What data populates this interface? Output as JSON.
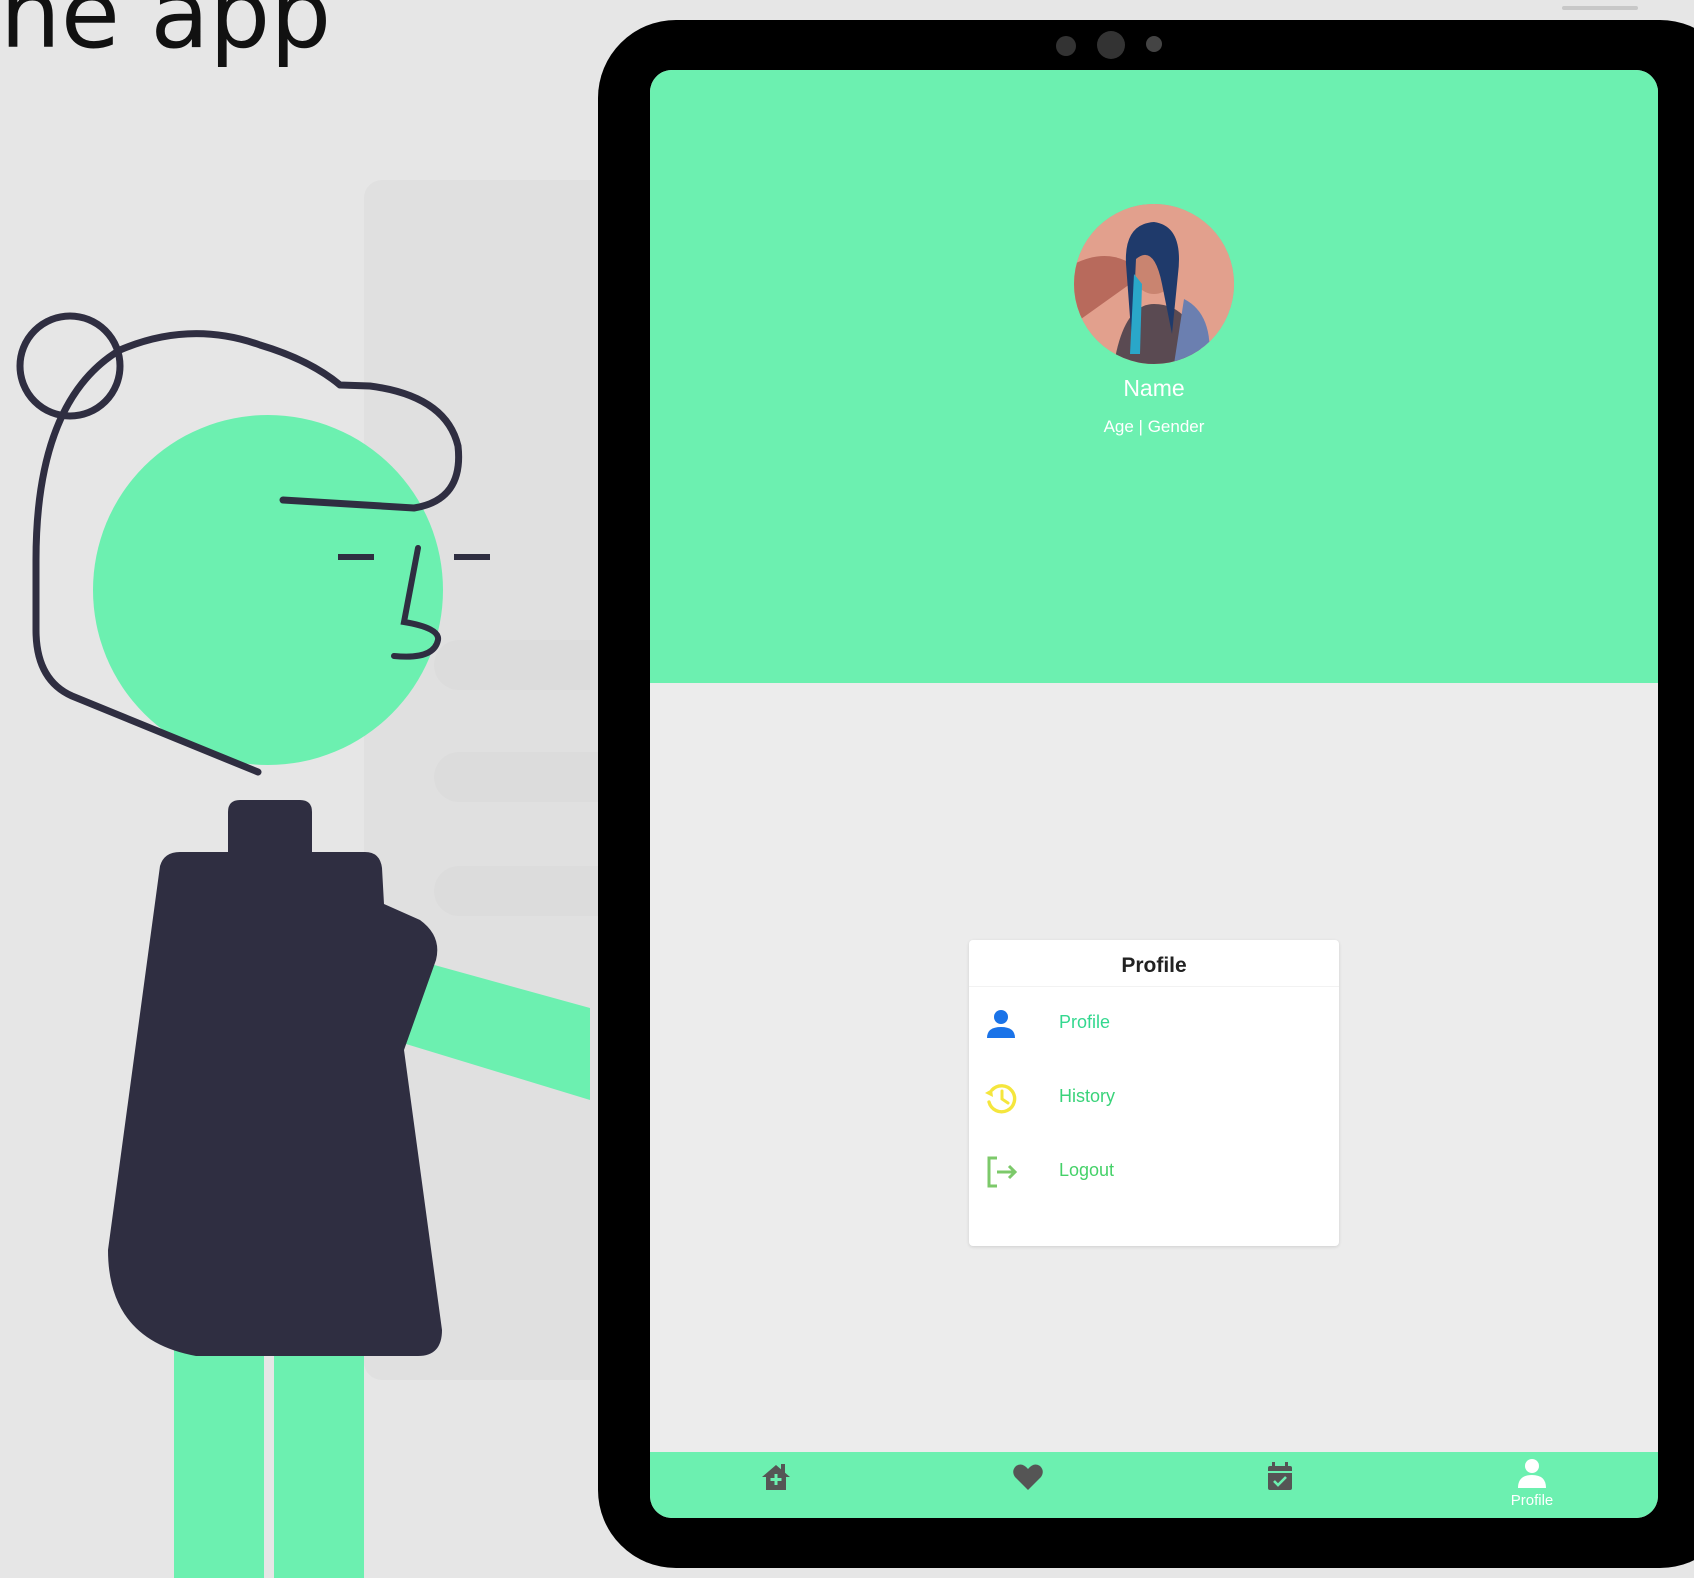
{
  "page": {
    "heading": "he app"
  },
  "profile": {
    "name": "Name",
    "subinfo": "Age | Gender"
  },
  "menu_card": {
    "title": "Profile",
    "items": [
      {
        "label": "Profile",
        "icon": "person-icon",
        "color": "#33d88f"
      },
      {
        "label": "History",
        "icon": "history-icon",
        "color": "#3ad37a"
      },
      {
        "label": "Logout",
        "icon": "logout-icon",
        "color": "#45d168"
      }
    ]
  },
  "bottom_nav": {
    "items": [
      {
        "icon": "home-plus-icon",
        "label": ""
      },
      {
        "icon": "heart-icon",
        "label": ""
      },
      {
        "icon": "calendar-check-icon",
        "label": ""
      },
      {
        "icon": "person-icon",
        "label": "Profile"
      }
    ]
  },
  "colors": {
    "accent": "#6cf0b0",
    "dark": "#2f2e41",
    "profile_icon": "#1a73e8",
    "history_icon": "#f5e63d",
    "logout_icon": "#7cc96a"
  }
}
